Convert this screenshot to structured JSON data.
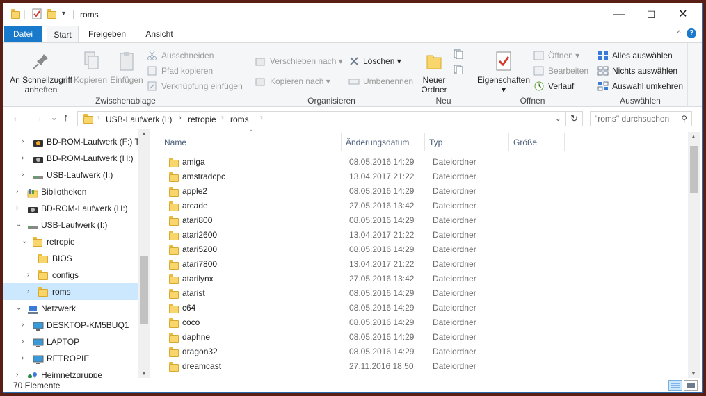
{
  "title_bar": {
    "title": "roms",
    "minimize_glyph": "—",
    "maximize_glyph": "☐",
    "close_glyph": "✕"
  },
  "ribbon_tabs": {
    "file": "Datei",
    "start": "Start",
    "share": "Freigeben",
    "view": "Ansicht",
    "collapse_glyph": "^",
    "help_glyph": "?"
  },
  "ribbon": {
    "clipboard": {
      "group_label": "Zwischenablage",
      "pin_line1": "An Schnellzugriff",
      "pin_line2": "anheften",
      "copy": "Kopieren",
      "paste": "Einfügen",
      "cut": "Ausschneiden",
      "copy_path": "Pfad kopieren",
      "paste_shortcut": "Verknüpfung einfügen"
    },
    "organize": {
      "group_label": "Organisieren",
      "move_to": "Verschieben nach",
      "copy_to": "Kopieren nach",
      "delete": "Löschen",
      "rename": "Umbenennen"
    },
    "new": {
      "group_label": "Neu",
      "new_folder_line1": "Neuer",
      "new_folder_line2": "Ordner"
    },
    "open": {
      "group_label": "Öffnen",
      "properties": "Eigenschaften",
      "open": "Öffnen",
      "edit": "Bearbeiten",
      "history": "Verlauf"
    },
    "select": {
      "group_label": "Auswählen",
      "select_all": "Alles auswählen",
      "select_none": "Nichts auswählen",
      "invert": "Auswahl umkehren"
    }
  },
  "address": {
    "back_glyph": "←",
    "forward_glyph": "→",
    "recent_glyph": "⌄",
    "up_glyph": "↑",
    "crumbs": [
      "USB-Laufwerk (I:)",
      "retropie",
      "roms"
    ],
    "refresh_glyph": "↻",
    "search_placeholder": "\"roms\" durchsuchen"
  },
  "nav_tree": [
    {
      "label": "BD-ROM-Laufwerk (F:) Ta",
      "icon": "bd-drive-icon"
    },
    {
      "label": "BD-ROM-Laufwerk (H:)",
      "icon": "bd-drive-icon"
    },
    {
      "label": "USB-Laufwerk (I:)",
      "icon": "usb-drive-icon"
    },
    {
      "label": "Bibliotheken",
      "icon": "libraries-icon"
    },
    {
      "label": "BD-ROM-Laufwerk (H:)",
      "icon": "bd-drive-icon"
    },
    {
      "label": "USB-Laufwerk (I:)",
      "icon": "usb-drive-icon"
    },
    {
      "label": "retropie",
      "icon": "folder-icon"
    },
    {
      "label": "BIOS",
      "icon": "folder-icon"
    },
    {
      "label": "configs",
      "icon": "folder-icon"
    },
    {
      "label": "roms",
      "icon": "folder-icon"
    },
    {
      "label": "Netzwerk",
      "icon": "network-icon"
    },
    {
      "label": "DESKTOP-KM5BUQ1",
      "icon": "computer-icon"
    },
    {
      "label": "LAPTOP",
      "icon": "computer-icon"
    },
    {
      "label": "RETROPIE",
      "icon": "computer-icon"
    },
    {
      "label": "Heimnetzgruppe",
      "icon": "homegroup-icon"
    }
  ],
  "columns": {
    "name": "Name",
    "date": "Änderungsdatum",
    "type": "Typ",
    "size": "Größe"
  },
  "files": [
    {
      "name": "amiga",
      "date": "08.05.2016 14:29",
      "type": "Dateiordner"
    },
    {
      "name": "amstradcpc",
      "date": "13.04.2017 21:22",
      "type": "Dateiordner"
    },
    {
      "name": "apple2",
      "date": "08.05.2016 14:29",
      "type": "Dateiordner"
    },
    {
      "name": "arcade",
      "date": "27.05.2016 13:42",
      "type": "Dateiordner"
    },
    {
      "name": "atari800",
      "date": "08.05.2016 14:29",
      "type": "Dateiordner"
    },
    {
      "name": "atari2600",
      "date": "13.04.2017 21:22",
      "type": "Dateiordner"
    },
    {
      "name": "atari5200",
      "date": "08.05.2016 14:29",
      "type": "Dateiordner"
    },
    {
      "name": "atari7800",
      "date": "13.04.2017 21:22",
      "type": "Dateiordner"
    },
    {
      "name": "atarilynx",
      "date": "27.05.2016 13:42",
      "type": "Dateiordner"
    },
    {
      "name": "atarist",
      "date": "08.05.2016 14:29",
      "type": "Dateiordner"
    },
    {
      "name": "c64",
      "date": "08.05.2016 14:29",
      "type": "Dateiordner"
    },
    {
      "name": "coco",
      "date": "08.05.2016 14:29",
      "type": "Dateiordner"
    },
    {
      "name": "daphne",
      "date": "08.05.2016 14:29",
      "type": "Dateiordner"
    },
    {
      "name": "dragon32",
      "date": "08.05.2016 14:29",
      "type": "Dateiordner"
    },
    {
      "name": "dreamcast",
      "date": "27.11.2016 18:50",
      "type": "Dateiordner"
    }
  ],
  "status": {
    "item_count": "70 Elemente"
  }
}
